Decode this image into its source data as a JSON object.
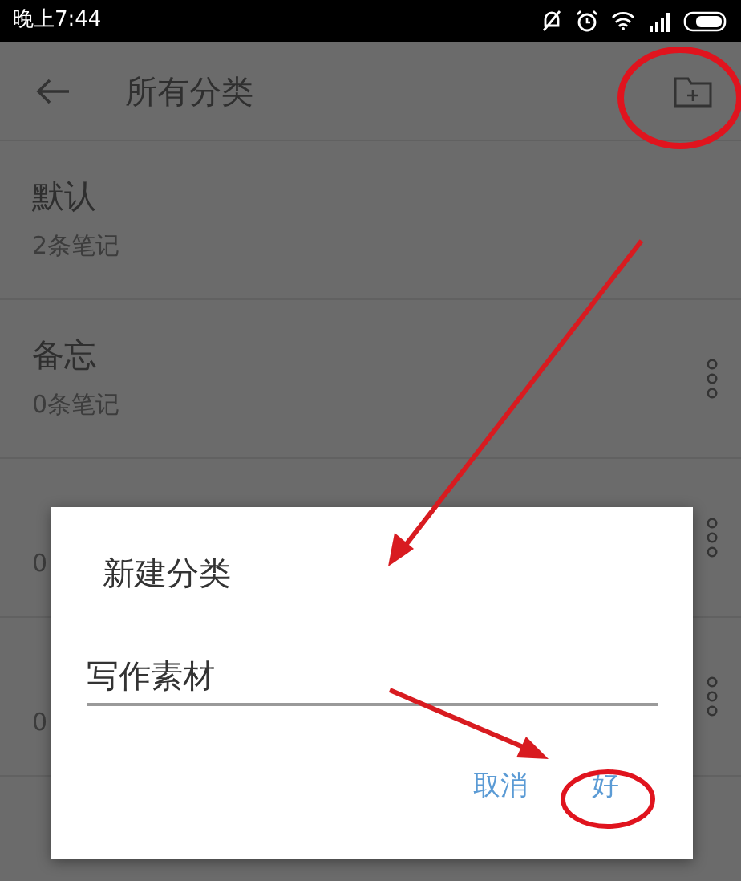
{
  "status_bar": {
    "time": "晚上7:44"
  },
  "app_bar": {
    "title": "所有分类"
  },
  "categories": [
    {
      "name": "默认",
      "count": "2条笔记",
      "menu": false
    },
    {
      "name": "备忘",
      "count": "0条笔记",
      "menu": true
    },
    {
      "count": "0",
      "menu": true
    },
    {
      "count": "0",
      "menu": true
    }
  ],
  "dialog": {
    "title": "新建分类",
    "value": "写作素材",
    "buttons": [
      {
        "label": "取消"
      },
      {
        "label": "好"
      }
    ]
  }
}
